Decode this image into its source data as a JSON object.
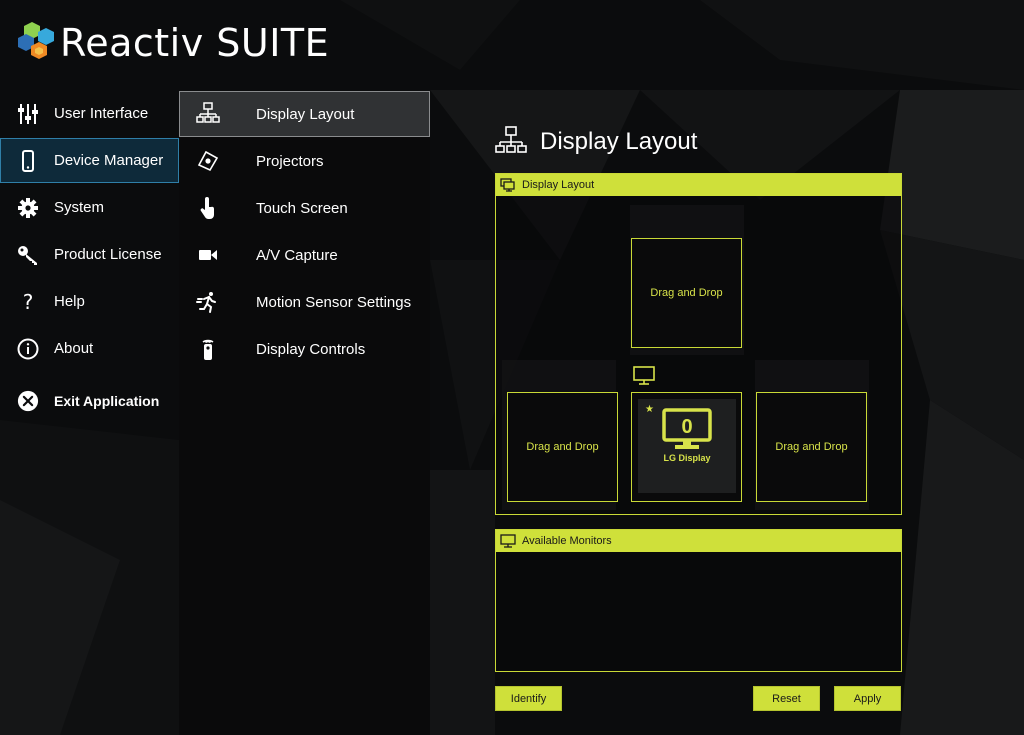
{
  "app": {
    "title": "Reactiv SUITE"
  },
  "nav_primary": [
    {
      "label": "User Interface",
      "icon": "sliders-icon"
    },
    {
      "label": "Device Manager",
      "icon": "phone-icon",
      "active": true
    },
    {
      "label": "System",
      "icon": "gear-icon"
    },
    {
      "label": "Product License",
      "icon": "key-icon"
    },
    {
      "label": "Help",
      "icon": "question-icon"
    },
    {
      "label": "About",
      "icon": "info-icon"
    },
    {
      "label": "Exit Application",
      "icon": "close-circle-icon"
    }
  ],
  "nav_secondary": [
    {
      "label": "Display Layout",
      "icon": "network-icon",
      "active": true
    },
    {
      "label": "Projectors",
      "icon": "projector-icon"
    },
    {
      "label": "Touch Screen",
      "icon": "touch-icon"
    },
    {
      "label": "A/V Capture",
      "icon": "video-camera-icon"
    },
    {
      "label": "Motion Sensor Settings",
      "icon": "running-icon"
    },
    {
      "label": "Display Controls",
      "icon": "remote-icon"
    }
  ],
  "content": {
    "title": "Display Layout",
    "layout_panel": {
      "header": "Display Layout",
      "drop_label": "Drag and Drop",
      "display": {
        "number": "0",
        "name": "LG Display",
        "primary": true
      }
    },
    "monitors_panel": {
      "header": "Available Monitors"
    },
    "buttons": {
      "identify": "Identify",
      "reset": "Reset",
      "apply": "Apply"
    }
  },
  "colors": {
    "accent": "#cfe03a",
    "active_primary": "#0e2a3a",
    "active_secondary": "#303234"
  }
}
